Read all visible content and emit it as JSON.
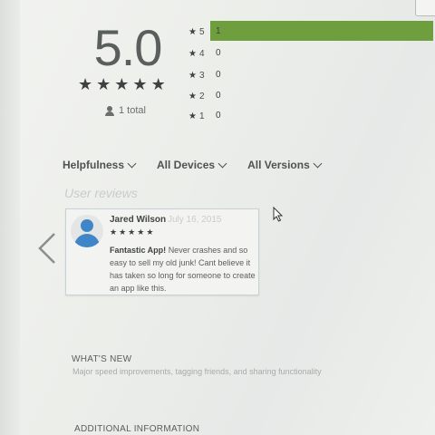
{
  "rating": {
    "score": "5.0",
    "summary_stars": 5,
    "total_label": "1 total",
    "distribution": [
      {
        "level": "5",
        "count": "1",
        "fraction": 1.0
      },
      {
        "level": "4",
        "count": "0",
        "fraction": 0
      },
      {
        "level": "3",
        "count": "0",
        "fraction": 0
      },
      {
        "level": "2",
        "count": "0",
        "fraction": 0
      },
      {
        "level": "1",
        "count": "0",
        "fraction": 0
      }
    ],
    "bar_color": "#6e9e3e"
  },
  "filters": [
    {
      "label": "Helpfulness"
    },
    {
      "label": "All Devices"
    },
    {
      "label": "All Versions"
    }
  ],
  "reviews_heading": "User reviews",
  "review": {
    "author": "Jared Wilson",
    "date": "July 16, 2015",
    "stars": 5,
    "title": "Fantastic App!",
    "body": "Never crashes and so easy to sell my old junk! Cant believe it has taken so long for someone to create an app like this."
  },
  "whats_new": {
    "heading": "WHAT'S NEW",
    "text": "Major speed improvements, tagging friends, and sharing functionality"
  },
  "additional_info": {
    "heading": "ADDITIONAL INFORMATION"
  },
  "icons": {
    "star": "star-icon",
    "person": "person-icon",
    "avatar": "avatar-icon",
    "prev": "chevron-left-icon",
    "cursor": "mouse-cursor-icon"
  },
  "accent_avatar": "#3f86c9"
}
